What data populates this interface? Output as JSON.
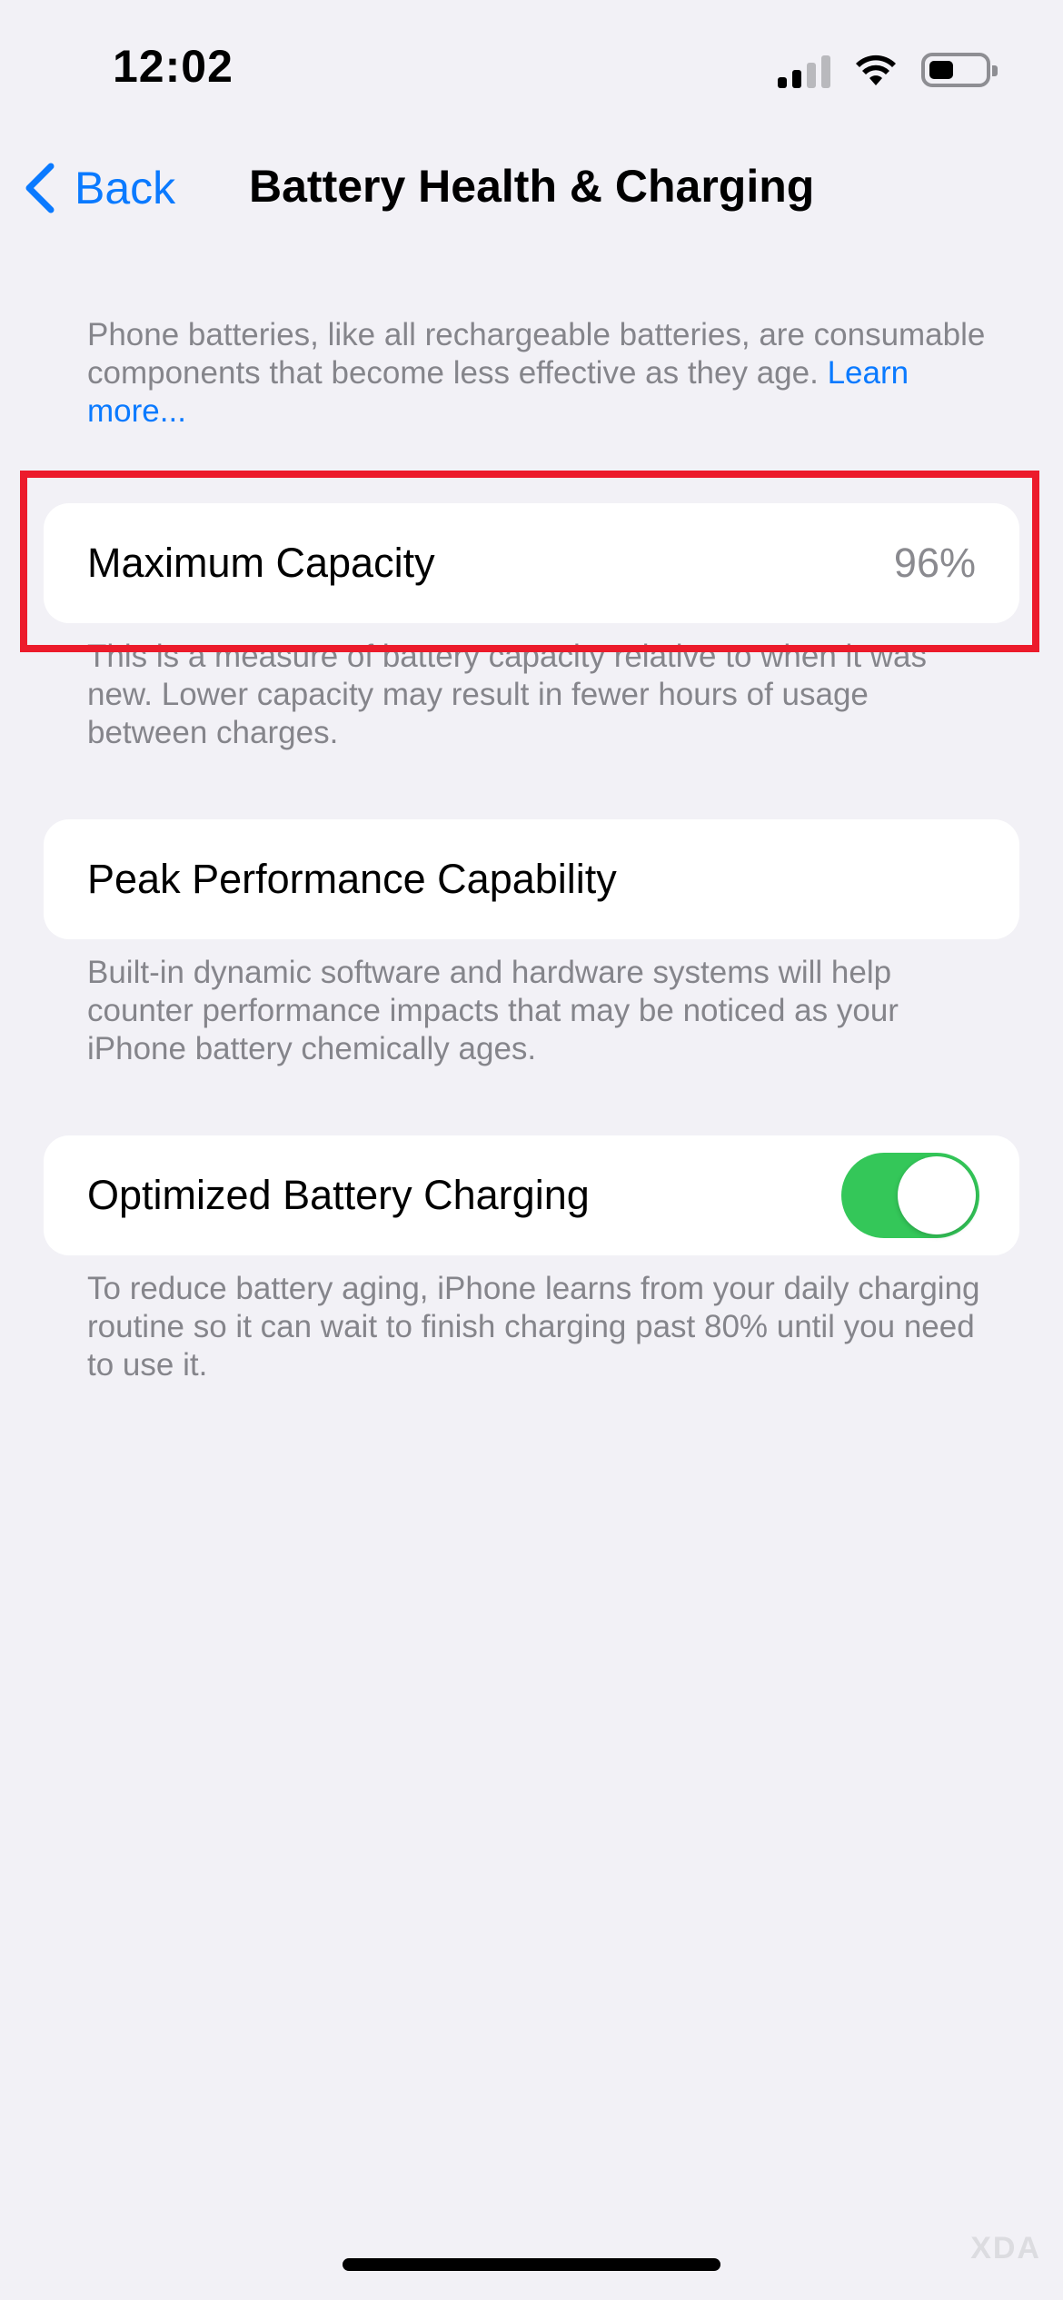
{
  "status_bar": {
    "time": "12:02"
  },
  "nav": {
    "back_label": "Back",
    "title": "Battery Health & Charging"
  },
  "intro": {
    "text": "Phone batteries, like all rechargeable batteries, are consumable components that become less effective as they age. ",
    "link": "Learn more..."
  },
  "maximum_capacity": {
    "label": "Maximum Capacity",
    "value": "96%",
    "footnote": "This is a measure of battery capacity relative to when it was new. Lower capacity may result in fewer hours of usage between charges."
  },
  "peak_performance": {
    "label": "Peak Performance Capability",
    "footnote": "Built-in dynamic software and hardware systems will help counter performance impacts that may be noticed as your iPhone battery chemically ages."
  },
  "optimized_charging": {
    "label": "Optimized Battery Charging",
    "enabled": true,
    "footnote": "To reduce battery aging, iPhone learns from your daily charging routine so it can wait to finish charging past 80% until you need to use it."
  },
  "colors": {
    "accent": "#0a7aff",
    "toggle_on": "#34c759",
    "highlight_box": "#ec1b2b",
    "background": "#f2f1f6"
  },
  "watermark": "XDA"
}
